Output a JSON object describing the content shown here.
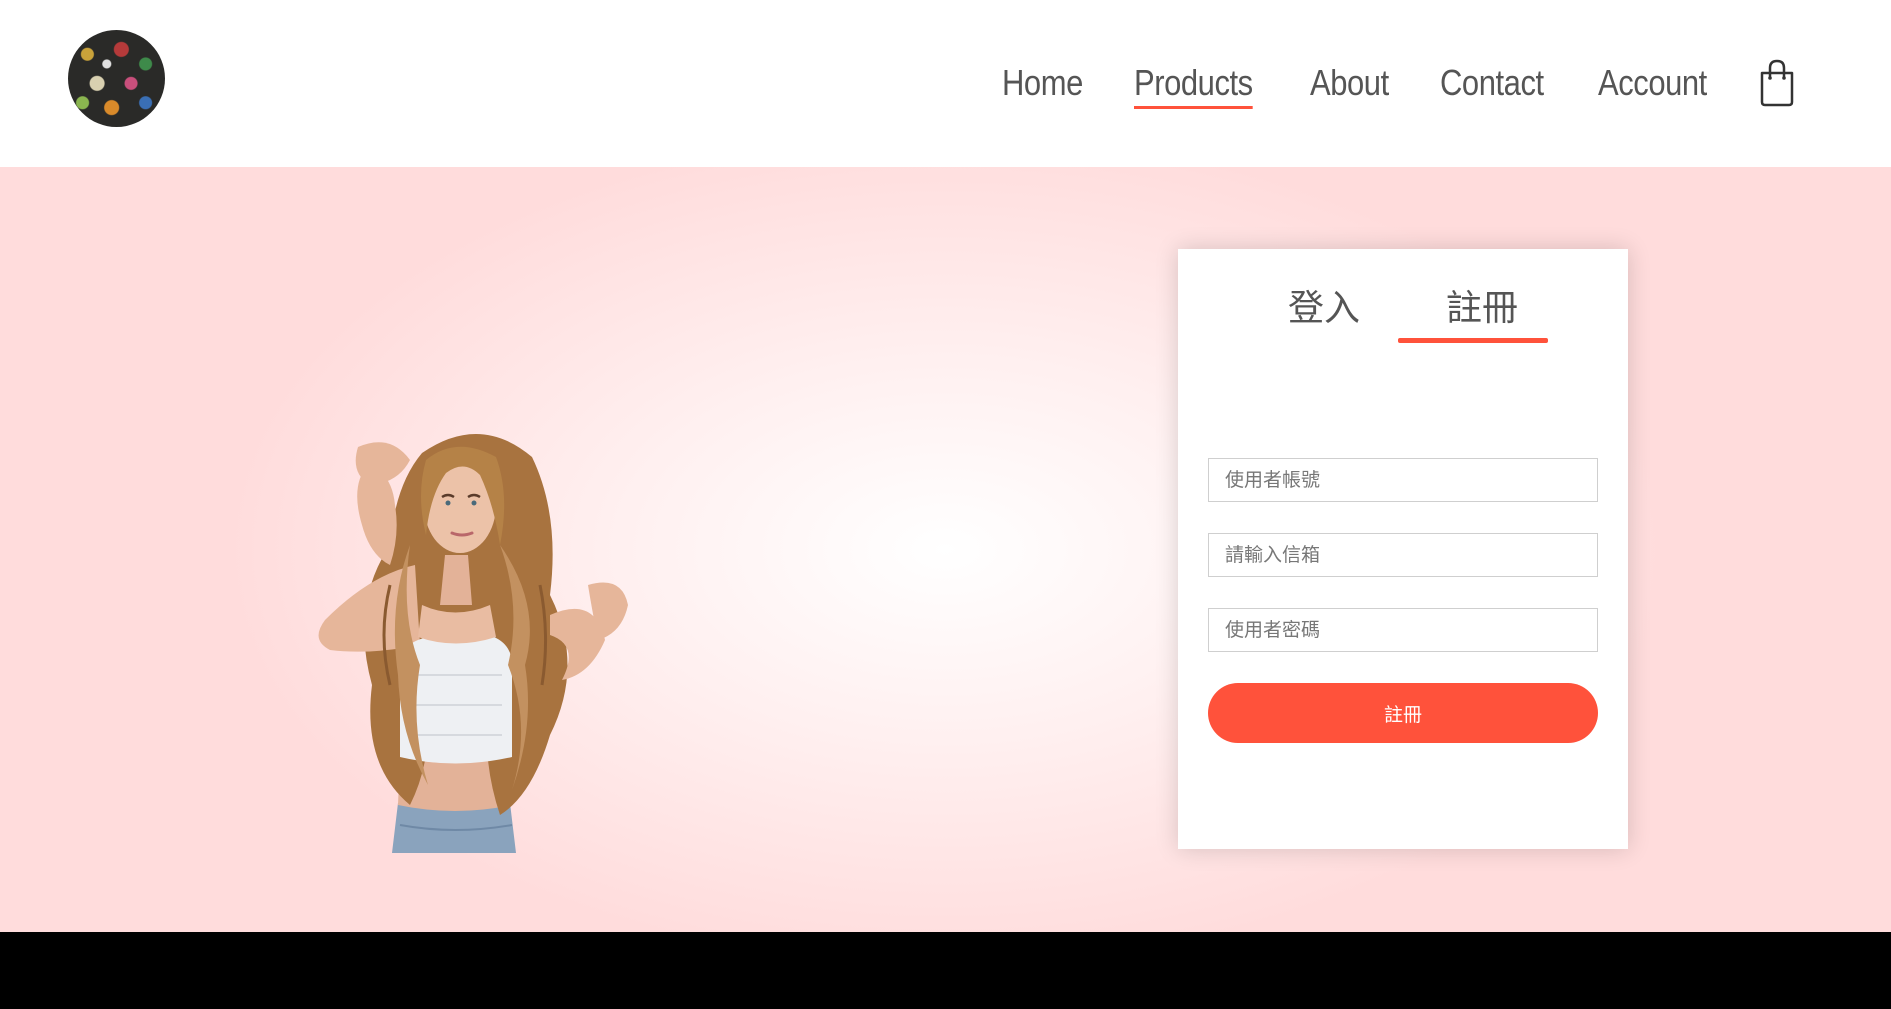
{
  "header": {
    "logo_alt": "store logo",
    "nav": [
      {
        "label": "Home",
        "active": false
      },
      {
        "label": "Products",
        "active": true
      },
      {
        "label": "About",
        "active": false
      },
      {
        "label": "Contact",
        "active": false
      },
      {
        "label": "Account",
        "active": false
      }
    ],
    "cart_icon": "shopping-bag-icon"
  },
  "hero": {
    "image_alt": "woman with long wavy hair"
  },
  "auth": {
    "tabs": [
      {
        "label": "登入",
        "active": false
      },
      {
        "label": "註冊",
        "active": true
      }
    ],
    "register": {
      "username_placeholder": "使用者帳號",
      "email_placeholder": "請輸入信箱",
      "password_placeholder": "使用者密碼",
      "submit_label": "註冊"
    }
  },
  "colors": {
    "accent": "#ff523b",
    "text": "#555555",
    "hero_gradient_outer": "#ffdcdc",
    "hero_gradient_inner": "#ffffff",
    "footer": "#000000"
  }
}
